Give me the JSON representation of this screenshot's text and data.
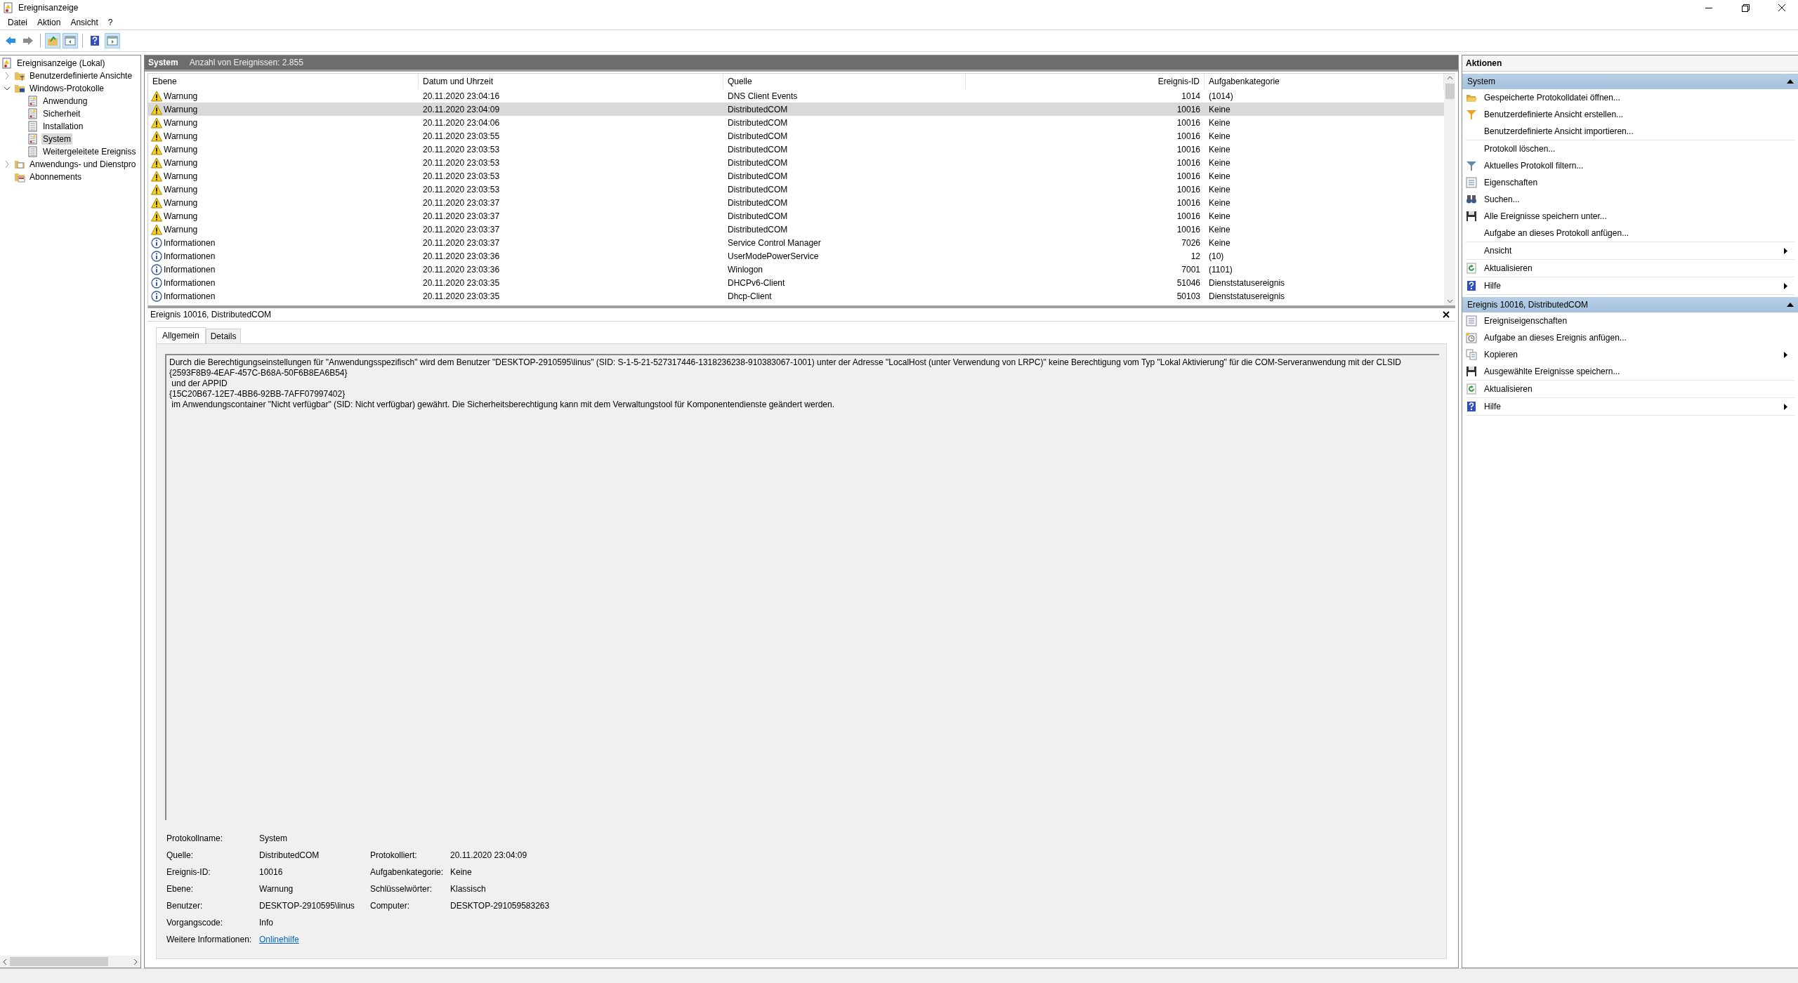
{
  "window": {
    "title": "Ereignisanzeige"
  },
  "menu": [
    "Datei",
    "Aktion",
    "Ansicht",
    "?"
  ],
  "toolbar": [
    {
      "kind": "back",
      "pressed": false
    },
    {
      "kind": "forward",
      "pressed": false
    },
    {
      "kind": "separator"
    },
    {
      "kind": "up",
      "pressed": true
    },
    {
      "kind": "tree",
      "pressed": true
    },
    {
      "kind": "separator"
    },
    {
      "kind": "help",
      "pressed": false
    },
    {
      "kind": "actions",
      "pressed": true
    }
  ],
  "tree": [
    {
      "label": "Ereignisanzeige (Lokal)",
      "kind": "root",
      "selected": false,
      "children": [
        {
          "label": "Benutzerdefinierte Ansichte",
          "kind": "filter-folder",
          "expanded": false,
          "selected": false
        },
        {
          "label": "Windows-Protokolle",
          "kind": "pc-folder",
          "expanded": true,
          "selected": false,
          "children": [
            {
              "label": "Anwendung",
              "kind": "log",
              "selected": false
            },
            {
              "label": "Sicherheit",
              "kind": "log",
              "selected": false
            },
            {
              "label": "Installation",
              "kind": "plain-log",
              "selected": false
            },
            {
              "label": "System",
              "kind": "log",
              "selected": true
            },
            {
              "label": "Weitergeleitete Ereigniss",
              "kind": "plain-log",
              "selected": false
            }
          ]
        },
        {
          "label": "Anwendungs- und Dienstpro",
          "kind": "folder",
          "expanded": false,
          "selected": false
        },
        {
          "label": "Abonnements",
          "kind": "sub-folder",
          "selected": false
        }
      ]
    }
  ],
  "events": {
    "title": "System",
    "count": "Anzahl von Ereignissen: 2.855",
    "columns": [
      "Ebene",
      "Datum und Uhrzeit",
      "Quelle",
      "Ereignis-ID",
      "Aufgabenkategorie"
    ],
    "rows": [
      {
        "kind": "warning",
        "cells": [
          "Warnung",
          "20.11.2020 23:04:16",
          "DNS Client Events",
          "1014",
          "(1014)"
        ],
        "selected": false
      },
      {
        "kind": "warning",
        "cells": [
          "Warnung",
          "20.11.2020 23:04:09",
          "DistributedCOM",
          "10016",
          "Keine"
        ],
        "selected": true
      },
      {
        "kind": "warning",
        "cells": [
          "Warnung",
          "20.11.2020 23:04:06",
          "DistributedCOM",
          "10016",
          "Keine"
        ],
        "selected": false
      },
      {
        "kind": "warning",
        "cells": [
          "Warnung",
          "20.11.2020 23:03:55",
          "DistributedCOM",
          "10016",
          "Keine"
        ],
        "selected": false
      },
      {
        "kind": "warning",
        "cells": [
          "Warnung",
          "20.11.2020 23:03:53",
          "DistributedCOM",
          "10016",
          "Keine"
        ],
        "selected": false
      },
      {
        "kind": "warning",
        "cells": [
          "Warnung",
          "20.11.2020 23:03:53",
          "DistributedCOM",
          "10016",
          "Keine"
        ],
        "selected": false
      },
      {
        "kind": "warning",
        "cells": [
          "Warnung",
          "20.11.2020 23:03:53",
          "DistributedCOM",
          "10016",
          "Keine"
        ],
        "selected": false
      },
      {
        "kind": "warning",
        "cells": [
          "Warnung",
          "20.11.2020 23:03:53",
          "DistributedCOM",
          "10016",
          "Keine"
        ],
        "selected": false
      },
      {
        "kind": "warning",
        "cells": [
          "Warnung",
          "20.11.2020 23:03:37",
          "DistributedCOM",
          "10016",
          "Keine"
        ],
        "selected": false
      },
      {
        "kind": "warning",
        "cells": [
          "Warnung",
          "20.11.2020 23:03:37",
          "DistributedCOM",
          "10016",
          "Keine"
        ],
        "selected": false
      },
      {
        "kind": "warning",
        "cells": [
          "Warnung",
          "20.11.2020 23:03:37",
          "DistributedCOM",
          "10016",
          "Keine"
        ],
        "selected": false
      },
      {
        "kind": "info",
        "cells": [
          "Informationen",
          "20.11.2020 23:03:37",
          "Service Control Manager",
          "7026",
          "Keine"
        ],
        "selected": false
      },
      {
        "kind": "info",
        "cells": [
          "Informationen",
          "20.11.2020 23:03:36",
          "UserModePowerService",
          "12",
          "(10)"
        ],
        "selected": false
      },
      {
        "kind": "info",
        "cells": [
          "Informationen",
          "20.11.2020 23:03:36",
          "Winlogon",
          "7001",
          "(1101)"
        ],
        "selected": false
      },
      {
        "kind": "info",
        "cells": [
          "Informationen",
          "20.11.2020 23:03:35",
          "DHCPv6-Client",
          "51046",
          "Dienststatusereignis"
        ],
        "selected": false
      },
      {
        "kind": "info",
        "cells": [
          "Informationen",
          "20.11.2020 23:03:35",
          "Dhcp-Client",
          "50103",
          "Dienststatusereignis"
        ],
        "selected": false
      }
    ]
  },
  "detail": {
    "title": "Ereignis 10016, DistributedCOM",
    "tabs": [
      {
        "label": "Allgemein",
        "selected": true
      },
      {
        "label": "Details",
        "selected": false
      }
    ],
    "description": "Durch die Berechtigungseinstellungen für \"Anwendungsspezifisch\" wird dem Benutzer \"DESKTOP-2910595\\linus\" (SID: S-1-5-21-527317446-1318236238-910383067-1001) unter der Adresse \"LocalHost (unter Verwendung von LRPC)\" keine Berechtigung vom Typ \"Lokal Aktivierung\" für die COM-Serveranwendung mit der CLSID \n{2593F8B9-4EAF-457C-B68A-50F6B8EA6B54}\n und der APPID \n{15C20B67-12E7-4BB6-92BB-7AFF07997402}\n im Anwendungscontainer \"Nicht verfügbar\" (SID: Nicht verfügbar) gewährt. Die Sicherheitsberechtigung kann mit dem Verwaltungstool für Komponentendienste geändert werden.",
    "fields": [
      {
        "left": {
          "label": "Protokollname:",
          "value": "System"
        }
      },
      {
        "left": {
          "label": "Quelle:",
          "value": "DistributedCOM"
        },
        "right": {
          "label": "Protokolliert:",
          "value": "20.11.2020 23:04:09"
        }
      },
      {
        "left": {
          "label": "Ereignis-ID:",
          "value": "10016"
        },
        "right": {
          "label": "Aufgabenkategorie:",
          "value": "Keine"
        }
      },
      {
        "left": {
          "label": "Ebene:",
          "value": "Warnung"
        },
        "right": {
          "label": "Schlüsselwörter:",
          "value": "Klassisch"
        }
      },
      {
        "left": {
          "label": "Benutzer:",
          "value": "DESKTOP-2910595\\linus"
        },
        "right": {
          "label": "Computer:",
          "value": "DESKTOP-291059583263"
        }
      },
      {
        "left": {
          "label": "Vorgangscode:",
          "value": "Info"
        }
      },
      {
        "left": {
          "label": "Weitere Informationen:",
          "value": "Onlinehilfe",
          "kind": "link"
        }
      }
    ]
  },
  "actions": {
    "title": "Aktionen",
    "sections": [
      {
        "title": "System",
        "expanded": true,
        "groups": [
          [
            {
              "label": "Gespeicherte Protokolldatei öffnen...",
              "kind": "open",
              "submenu": false
            },
            {
              "label": "Benutzerdefinierte Ansicht erstellen...",
              "kind": "filter-color",
              "submenu": false
            },
            {
              "label": "Benutzerdefinierte Ansicht importieren...",
              "kind": "none",
              "submenu": false
            }
          ],
          [
            {
              "label": "Protokoll löschen...",
              "kind": "none",
              "submenu": false
            },
            {
              "label": "Aktuelles Protokoll filtern...",
              "kind": "filter",
              "submenu": false
            },
            {
              "label": "Eigenschaften",
              "kind": "props",
              "submenu": false
            },
            {
              "label": "Suchen...",
              "kind": "find",
              "submenu": false
            },
            {
              "label": "Alle Ereignisse speichern unter...",
              "kind": "save",
              "submenu": false
            },
            {
              "label": "Aufgabe an dieses Protokoll anfügen...",
              "kind": "none",
              "submenu": false
            }
          ],
          [
            {
              "label": "Ansicht",
              "kind": "none",
              "submenu": true
            }
          ],
          [
            {
              "label": "Aktualisieren",
              "kind": "refresh",
              "submenu": false
            }
          ],
          [
            {
              "label": "Hilfe",
              "kind": "help",
              "submenu": true
            }
          ]
        ]
      },
      {
        "title": "Ereignis 10016, DistributedCOM",
        "expanded": true,
        "groups": [
          [
            {
              "label": "Ereigniseigenschaften",
              "kind": "props",
              "submenu": false
            },
            {
              "label": "Aufgabe an dieses Ereignis anfügen...",
              "kind": "task",
              "submenu": false
            },
            {
              "label": "Kopieren",
              "kind": "copy",
              "submenu": true
            },
            {
              "label": "Ausgewählte Ereignisse speichern...",
              "kind": "save",
              "submenu": false
            }
          ],
          [
            {
              "label": "Aktualisieren",
              "kind": "refresh",
              "submenu": false
            }
          ],
          [
            {
              "label": "Hilfe",
              "kind": "help",
              "submenu": true
            }
          ]
        ]
      }
    ]
  }
}
